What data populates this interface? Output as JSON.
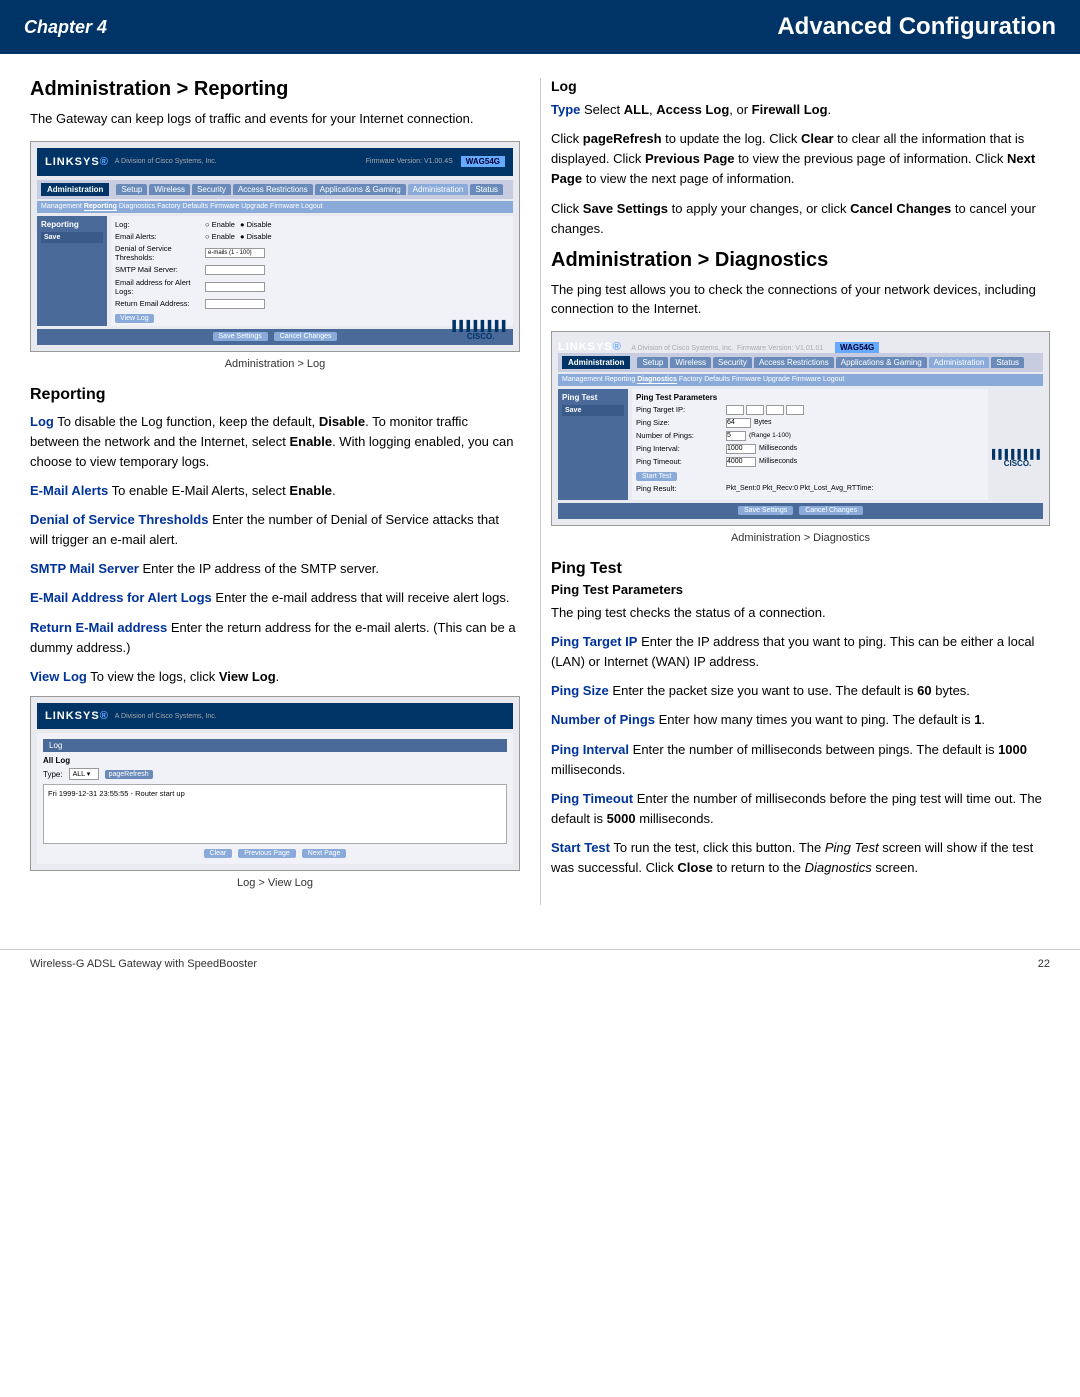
{
  "header": {
    "chapter_label": "Chapter 4",
    "page_title": "Advanced Configuration"
  },
  "left_col": {
    "section_title": "Administration > Reporting",
    "section_intro": "The Gateway can keep logs of traffic and events for your Internet connection.",
    "screenshot1_caption": "Administration > Log",
    "subsection_reporting": "Reporting",
    "para_log": {
      "term": "Log",
      "text": "  To disable the Log function, keep the default, ",
      "bold1": "Disable",
      "text2": ". To monitor traffic between the network and the Internet, select ",
      "bold2": "Enable",
      "text3": ". With logging enabled, you can choose to view temporary logs."
    },
    "para_email_alerts": {
      "term": "E-Mail Alerts",
      "text": "  To enable E-Mail Alerts, select ",
      "bold": "Enable",
      "text2": "."
    },
    "para_denial": {
      "term": "Denial of Service Thresholds",
      "text": "  Enter the number of Denial of Service attacks that will trigger an e-mail alert."
    },
    "para_smtp": {
      "term": "SMTP Mail Server",
      "text": "  Enter the IP address of the SMTP server."
    },
    "para_email_address": {
      "term": "E-Mail Address for Alert Logs",
      "text": "  Enter the e-mail address that will receive alert logs."
    },
    "para_return_email": {
      "term": "Return E-Mail address",
      "text": "  Enter the return address for the e-mail alerts. (This can be a dummy address.)"
    },
    "para_view_log": {
      "term": "View Log",
      "text": "  To view the logs, click ",
      "bold": "View Log",
      "text2": "."
    },
    "screenshot2_caption": "Log > View Log",
    "linksys_label": "LINKSYS",
    "nav_tabs": [
      "Setup",
      "Wireless",
      "Security",
      "Access Restrictions",
      "Applications & Gaming",
      "Administration",
      "Status"
    ],
    "sub_tabs": [
      "Management",
      "Reporting",
      "Diagnostics",
      "Factory Defaults",
      "Firmware Upgrade",
      "Firmware Logout"
    ],
    "form_fields": [
      {
        "label": "Log:",
        "type": "radio",
        "options": [
          "Enable",
          "Disable"
        ]
      },
      {
        "label": "E-mail Alerts:",
        "type": "radio",
        "options": [
          "Enable",
          "Disable"
        ]
      },
      {
        "label": "Denial of Service Thresholds:",
        "type": "input",
        "value": "e-mails (1 - 100)"
      },
      {
        "label": "SMTP Mail Server:",
        "type": "input",
        "value": ""
      },
      {
        "label": "Email address for Alert Logs:",
        "type": "input",
        "value": ""
      },
      {
        "label": "Return Email Address:",
        "type": "input",
        "value": ""
      }
    ],
    "view_log_btn": "View Log",
    "save_btn": "Save Settings",
    "cancel_btn": "Cancel Changes",
    "log_screen": {
      "log_title": "Log",
      "all_log_label": "All Log",
      "type_label": "Type:",
      "type_value": "ALL",
      "pagerefresh_btn": "pageRefresh",
      "log_entry": "Fri 1999-12-31 23:55:55 - Router start up",
      "clear_btn": "Clear",
      "previous_btn": "Previous Page",
      "next_btn": "Next Page"
    }
  },
  "right_col": {
    "log_section": {
      "title": "Log",
      "para_type": {
        "term": "Type",
        "text": "  Select ",
        "bold1": "ALL",
        "text2": ", ",
        "bold2": "Access Log",
        "text3": ", or ",
        "bold3": "Firewall Log",
        "text4": "."
      },
      "para_pagerefresh": {
        "text": "Click ",
        "bold1": "pageRefresh",
        "text2": " to update the log. Click ",
        "bold2": "Clear",
        "text3": " to clear all the information that is displayed. Click ",
        "bold3": "Previous Page",
        "text4": " to view the previous page of information. Click ",
        "bold4": "Next Page",
        "text5": " to view the next page of information."
      },
      "para_save": {
        "text": "Click ",
        "bold1": "Save Settings",
        "text2": " to apply your changes, or click ",
        "bold2": "Cancel Changes",
        "text3": " to cancel your changes."
      }
    },
    "diagnostics_section": {
      "title": "Administration > Diagnostics",
      "intro": "The ping test allows you to check the connections of your network devices, including connection to the Internet.",
      "screenshot_caption": "Administration > Diagnostics",
      "diag_form": {
        "ping_target_label": "Ping Target IP:",
        "ping_size_label": "Ping Size:",
        "ping_size_value": "64",
        "ping_size_unit": "Bytes",
        "num_pings_label": "Number of Pings:",
        "num_pings_value": "5",
        "num_pings_range": "(Range 1-100)",
        "ping_interval_label": "Ping Interval:",
        "ping_interval_value": "1000",
        "ping_interval_unit": "Milliseconds",
        "ping_timeout_label": "Ping Timeout:",
        "ping_timeout_value": "4000",
        "ping_timeout_unit": "Milliseconds",
        "start_test_btn": "Start Test",
        "ping_result_label": "Ping Result:",
        "ping_result_value": "Pkt_Sent:0 Pkt_Recv:0 Pkt_Lost_Avg_RTTime:"
      },
      "save_btn": "Save Settings",
      "cancel_btn": "Cancel Changes"
    },
    "ping_test_section": {
      "title": "Ping Test",
      "subtitle": "Ping Test Parameters",
      "intro": "The ping test checks the status of a connection.",
      "para_target": {
        "term": "Ping Target IP",
        "text": "  Enter the IP address that you want to ping. This can be either a local (LAN) or Internet (WAN) IP address."
      },
      "para_size": {
        "term": "Ping Size",
        "text": "  Enter the packet size you want to use. The default is ",
        "bold": "60",
        "text2": " bytes."
      },
      "para_num_pings": {
        "term": "Number of Pings",
        "text": "  Enter how many times you want to ping. The default is ",
        "bold": "1",
        "text2": "."
      },
      "para_interval": {
        "term": "Ping Interval",
        "text": "  Enter the number of milliseconds between pings. The default is ",
        "bold": "1000",
        "text2": " milliseconds."
      },
      "para_timeout": {
        "term": "Ping Timeout",
        "text": "  Enter the number of milliseconds before the ping test will time out. The default is ",
        "bold": "5000",
        "text2": " milliseconds."
      },
      "para_start_test": {
        "term": "Start Test",
        "text": "  To run the test, click this button. The ",
        "italic": "Ping Test",
        "text2": " screen will show if the test was successful. Click ",
        "bold": "Close",
        "text3": " to return to the ",
        "italic2": "Diagnostics",
        "text4": " screen."
      }
    }
  },
  "footer": {
    "product_name": "Wireless-G ADSL Gateway with SpeedBooster",
    "page_number": "22"
  }
}
